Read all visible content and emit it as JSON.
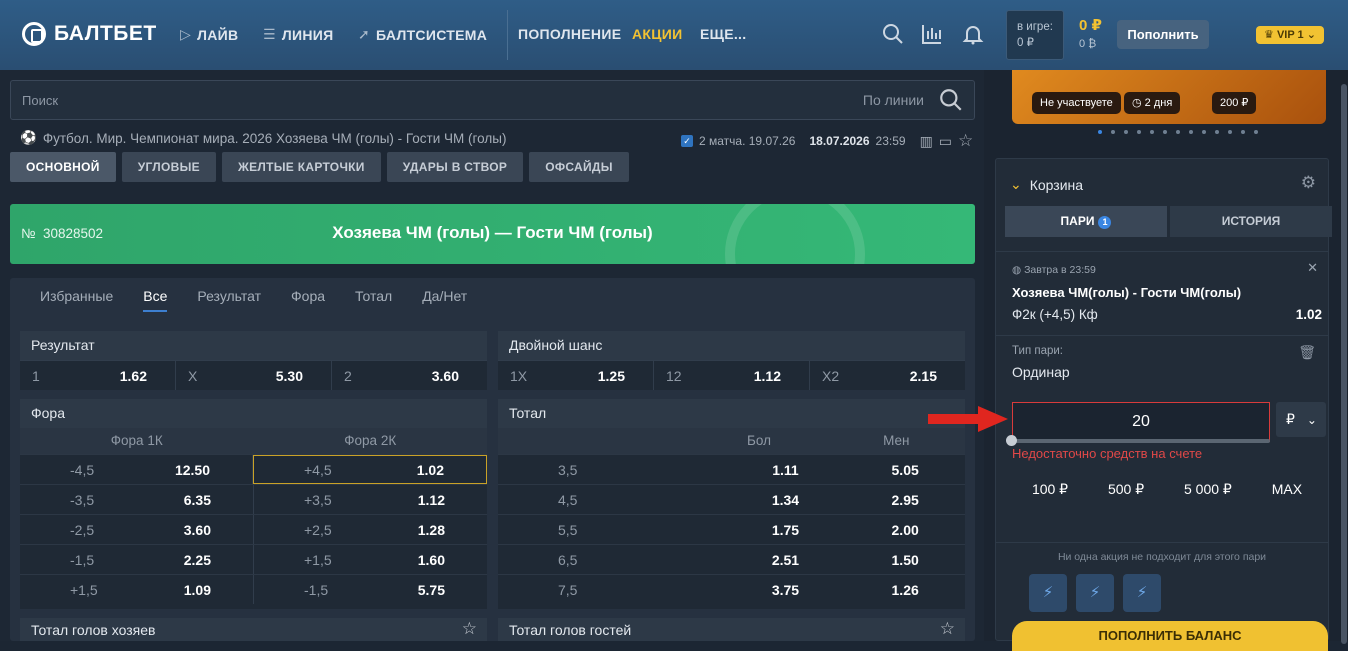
{
  "header": {
    "logo": "БАЛТБЕТ",
    "nav": [
      {
        "label": "ЛАЙВ"
      },
      {
        "label": "ЛИНИЯ"
      },
      {
        "label": "БАЛТСИСТЕМА"
      }
    ],
    "links": [
      {
        "label": "ПОПОЛНЕНИЕ"
      },
      {
        "label": "АКЦИИ"
      },
      {
        "label": "ЕЩЕ..."
      }
    ],
    "in_game_label": "в игре:",
    "in_game_value": "0 ₽",
    "balance_main": "0 ₽",
    "balance_bonus": "0 ₿",
    "deposit_button": "Пополнить",
    "vip_label": "VIP 1"
  },
  "search": {
    "placeholder": "Поиск",
    "mode": "По линии"
  },
  "breadcrumb": {
    "text": "Футбол. Мир. Чемпионат мира. 2026  Хозяева ЧМ (голы) - Гости ЧМ (голы)",
    "matches": "2 матча. 19.07.26",
    "date": "18.07.2026",
    "time": "23:59"
  },
  "market_tabs": [
    "ОСНОВНОЙ",
    "УГЛОВЫЕ",
    "ЖЕЛТЫЕ КАРТОЧКИ",
    "УДАРЫ В СТВОР",
    "ОФСАЙДЫ"
  ],
  "match": {
    "no_label": "№",
    "number": "30828502",
    "title": "Хозяева ЧМ (голы) — Гости ЧМ (голы)"
  },
  "filters": [
    "Избранные",
    "Все",
    "Результат",
    "Фора",
    "Тотал",
    "Да/Нет"
  ],
  "result": {
    "title": "Результат",
    "cells": [
      {
        "n": "1",
        "v": "1.62"
      },
      {
        "n": "X",
        "v": "5.30"
      },
      {
        "n": "2",
        "v": "3.60"
      }
    ]
  },
  "double": {
    "title": "Двойной шанс",
    "cells": [
      {
        "n": "1X",
        "v": "1.25"
      },
      {
        "n": "12",
        "v": "1.12"
      },
      {
        "n": "X2",
        "v": "2.15"
      }
    ]
  },
  "fora": {
    "title": "Фора",
    "col1": "Фора 1К",
    "col2": "Фора 2К",
    "rows": [
      [
        "-4,5",
        "12.50",
        "+4,5",
        "1.02"
      ],
      [
        "-3,5",
        "6.35",
        "+3,5",
        "1.12"
      ],
      [
        "-2,5",
        "3.60",
        "+2,5",
        "1.28"
      ],
      [
        "-1,5",
        "2.25",
        "+1,5",
        "1.60"
      ],
      [
        "+1,5",
        "1.09",
        "-1,5",
        "5.75"
      ]
    ]
  },
  "total": {
    "title": "Тотал",
    "col1": "Бол",
    "col2": "Мен",
    "rows": [
      [
        "3,5",
        "1.11",
        "5.05"
      ],
      [
        "4,5",
        "1.34",
        "2.95"
      ],
      [
        "5,5",
        "1.75",
        "2.00"
      ],
      [
        "6,5",
        "2.51",
        "1.50"
      ],
      [
        "7,5",
        "3.75",
        "1.26"
      ]
    ]
  },
  "bottom": {
    "home": "Тотал голов хозяев",
    "away": "Тотал голов гостей"
  },
  "promo": {
    "status": "Не участвуете",
    "days": "2 дня",
    "amount": "200 ₽"
  },
  "cart": {
    "title": "Корзина",
    "tab_bets": "ПАРИ",
    "bets_count": "1",
    "tab_history": "ИСТОРИЯ",
    "when": "Завтра в 23:59",
    "event": "Хозяева ЧМ(голы) - Гости ЧМ(голы)",
    "outcome": "Ф2к (+4,5) Кф",
    "odd": "1.02",
    "type_label": "Тип пари:",
    "type_value": "Ординар",
    "stake": "20",
    "currency": "₽",
    "error": "Недостаточно средств на счете",
    "quick": [
      "100 ₽",
      "500 ₽",
      "5 000 ₽",
      "MAX"
    ],
    "note": "Ни одна акция не подходит для этого пари",
    "topup": "ПОПОЛНИТЬ БАЛАНС"
  }
}
